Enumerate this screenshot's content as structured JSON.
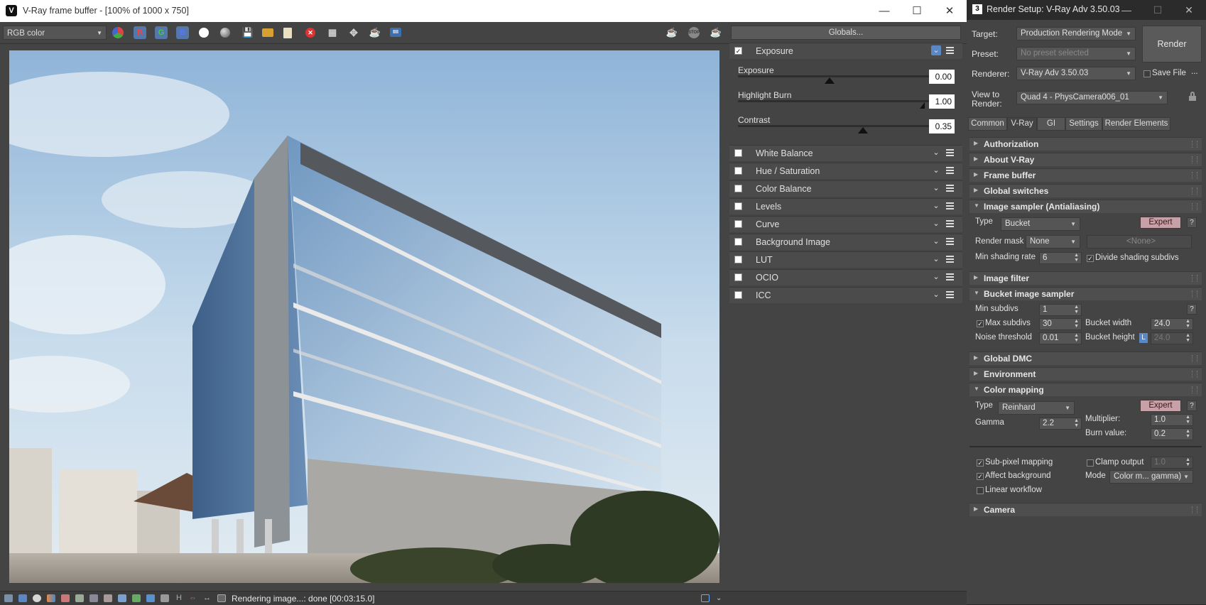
{
  "vfb": {
    "title": "V-Ray frame buffer - [100% of 1000 x 750]",
    "channel": "RGB color",
    "status": "Rendering image...: done [00:03:15.0]",
    "globals_label": "Globals...",
    "exposure": {
      "label": "Exposure",
      "sliders": [
        {
          "label": "Exposure",
          "value": "0.00"
        },
        {
          "label": "Highlight Burn",
          "value": "1.00"
        },
        {
          "label": "Contrast",
          "value": "0.35"
        }
      ]
    },
    "corrections": [
      "White Balance",
      "Hue / Saturation",
      "Color Balance",
      "Levels",
      "Curve",
      "Background Image",
      "LUT",
      "OCIO",
      "ICC"
    ]
  },
  "rs": {
    "title": "Render Setup: V-Ray Adv 3.50.03",
    "target_label": "Target:",
    "target": "Production Rendering Mode",
    "preset_label": "Preset:",
    "preset": "No preset selected",
    "renderer_label": "Renderer:",
    "renderer": "V-Ray Adv 3.50.03",
    "save_file": "Save File",
    "more": "...",
    "view_label_1": "View to",
    "view_label_2": "Render:",
    "view": "Quad 4 - PhysCamera006_01",
    "render_btn": "Render",
    "tabs": [
      "Common",
      "V-Ray",
      "GI",
      "Settings",
      "Render Elements"
    ],
    "rollouts": {
      "authorization": "Authorization",
      "about": "About V-Ray",
      "frame_buffer": "Frame buffer",
      "global_switches": "Global switches",
      "image_sampler": "Image sampler (Antialiasing)",
      "image_filter": "Image filter",
      "bucket": "Bucket image sampler",
      "global_dmc": "Global DMC",
      "environment": "Environment",
      "color_mapping": "Color mapping",
      "camera": "Camera"
    },
    "sampler": {
      "type_label": "Type",
      "type": "Bucket",
      "expert": "Expert",
      "help": "?",
      "mask_label": "Render mask",
      "mask": "None",
      "mask_obj": "<None>",
      "min_rate_label": "Min shading rate",
      "min_rate": "6",
      "divide": "Divide shading subdivs"
    },
    "bucket": {
      "min_label": "Min subdivs",
      "min": "1",
      "max_label": "Max subdivs",
      "max": "30",
      "noise_label": "Noise threshold",
      "noise": "0.01",
      "bw_label": "Bucket width",
      "bw": "24.0",
      "bh_label": "Bucket height",
      "bh": "24.0",
      "lock": "L",
      "help": "?"
    },
    "cmap": {
      "type_label": "Type",
      "type": "Reinhard",
      "expert": "Expert",
      "help": "?",
      "gamma_label": "Gamma",
      "gamma": "2.2",
      "mult_label": "Multiplier:",
      "mult": "1.0",
      "burn_label": "Burn value:",
      "burn": "0.2",
      "subpixel": "Sub-pixel mapping",
      "clamp": "Clamp output",
      "clamp_val": "1.0",
      "affect": "Affect background",
      "mode_label": "Mode",
      "mode": "Color m... gamma)",
      "linear": "Linear workflow"
    }
  }
}
